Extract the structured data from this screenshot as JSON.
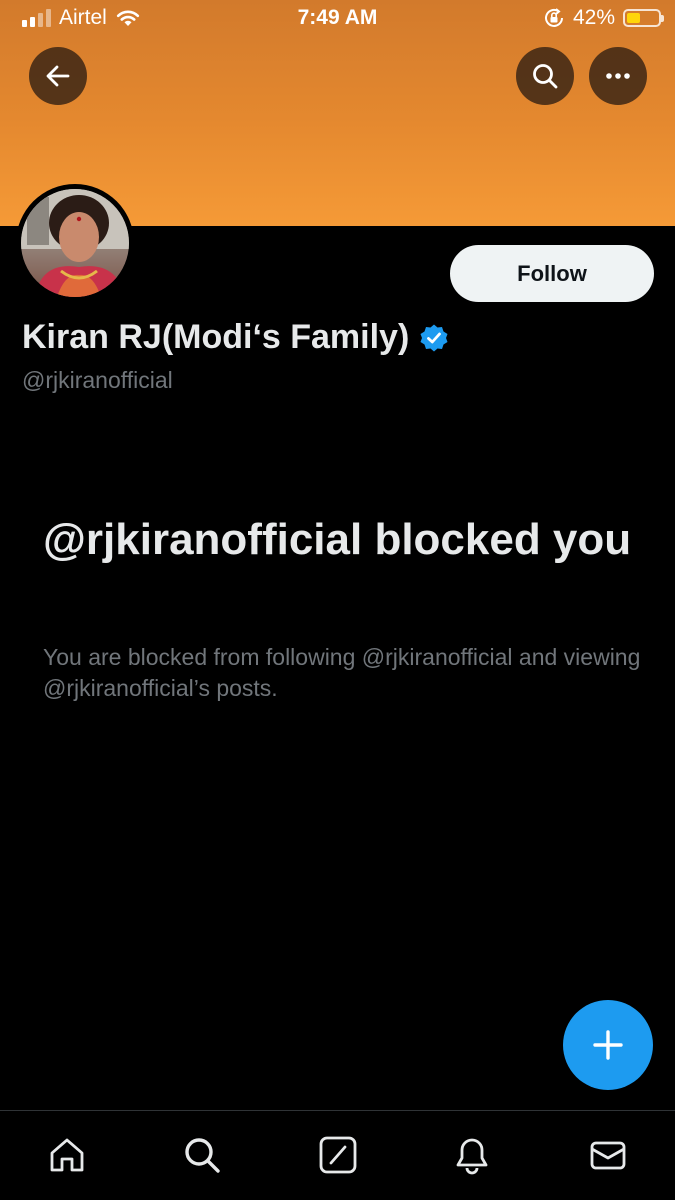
{
  "status_bar": {
    "carrier": "Airtel",
    "time": "7:49 AM",
    "battery_percent": "42%",
    "battery_level": 0.42,
    "icons": [
      "cellular-signal-icon",
      "wifi-icon",
      "orientation-lock-icon",
      "battery-icon"
    ]
  },
  "colors": {
    "banner": "#e5892f",
    "accent_blue": "#1d9bf0",
    "background": "#000000",
    "battery_fill": "#ffd60a"
  },
  "header": {
    "icons": [
      "back-arrow-icon",
      "search-icon",
      "more-options-icon"
    ]
  },
  "profile": {
    "name": "Kiran RJ(Modi‘s Family)",
    "handle": "@rjkiranofficial",
    "verified": true,
    "follow_label": "Follow"
  },
  "blocked": {
    "title": "@rjkiranofficial blocked you",
    "description": "You are blocked from following @rjkiranofficial and viewing @rjkiranofficial’s posts."
  },
  "fab": {
    "icon": "plus-icon"
  },
  "tabbar": {
    "items": [
      "home-icon",
      "search-icon",
      "grok-icon",
      "notifications-icon",
      "messages-icon"
    ]
  }
}
